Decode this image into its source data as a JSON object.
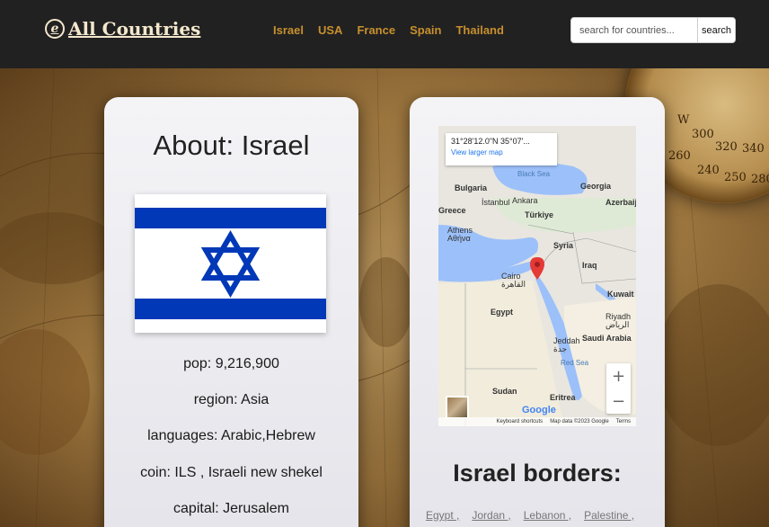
{
  "brand": {
    "logo_letter": "e",
    "title": "All Countries"
  },
  "nav": {
    "links": [
      "Israel",
      "USA",
      "France",
      "Spain",
      "Thailand"
    ]
  },
  "search": {
    "placeholder": "search for countries...",
    "button_label": "search"
  },
  "background": {
    "compass_text": [
      "W",
      "300",
      "320",
      "340",
      "260",
      "240",
      "250",
      "280"
    ]
  },
  "about": {
    "title": "About: Israel",
    "flag": {
      "colors": {
        "white": "#ffffff",
        "blue": "#0038b8"
      },
      "icon": "star-of-david-icon"
    },
    "pop": "pop: 9,216,900",
    "region": "region: Asia",
    "languages": "languages: Arabic,Hebrew",
    "coin": "coin: ILS , Israeli new shekel",
    "capital": "capital: Jerusalem"
  },
  "map": {
    "coords": "31°28'12.0\"N 35°07'...",
    "view_larger": "View larger map",
    "labels": {
      "black_sea": "Black Sea",
      "bulgaria": "Bulgaria",
      "georgia": "Georgia",
      "istanbul": "İstanbul",
      "ankara": "Ankara",
      "greece": "Greece",
      "turkiye": "Türkiye",
      "azerbaijan": "Azerbaij",
      "athens": "Athens",
      "athens_gr": "Αθήνα",
      "syria": "Syria",
      "iraq": "Iraq",
      "cairo": "Cairo",
      "cairo_ar": "القاهرة",
      "kuwait": "Kuwait",
      "egypt": "Egypt",
      "riyadh": "Riyadh",
      "riyadh_ar": "الرياض",
      "saudi_arabia": "Saudi Arabia",
      "jeddah": "Jeddah",
      "jeddah_ar": "جدة",
      "red_sea": "Red Sea",
      "sudan": "Sudan",
      "eritrea": "Eritrea"
    },
    "google": "Google",
    "footer": {
      "shortcuts": "Keyboard shortcuts",
      "data": "Map data ©2023 Google",
      "terms": "Terms"
    },
    "zoom_in": "+",
    "zoom_out": "−"
  },
  "borders": {
    "title": "Israel borders:",
    "items": [
      "Egypt ,",
      "Jordan ,",
      "Lebanon ,",
      "Palestine ,"
    ]
  }
}
